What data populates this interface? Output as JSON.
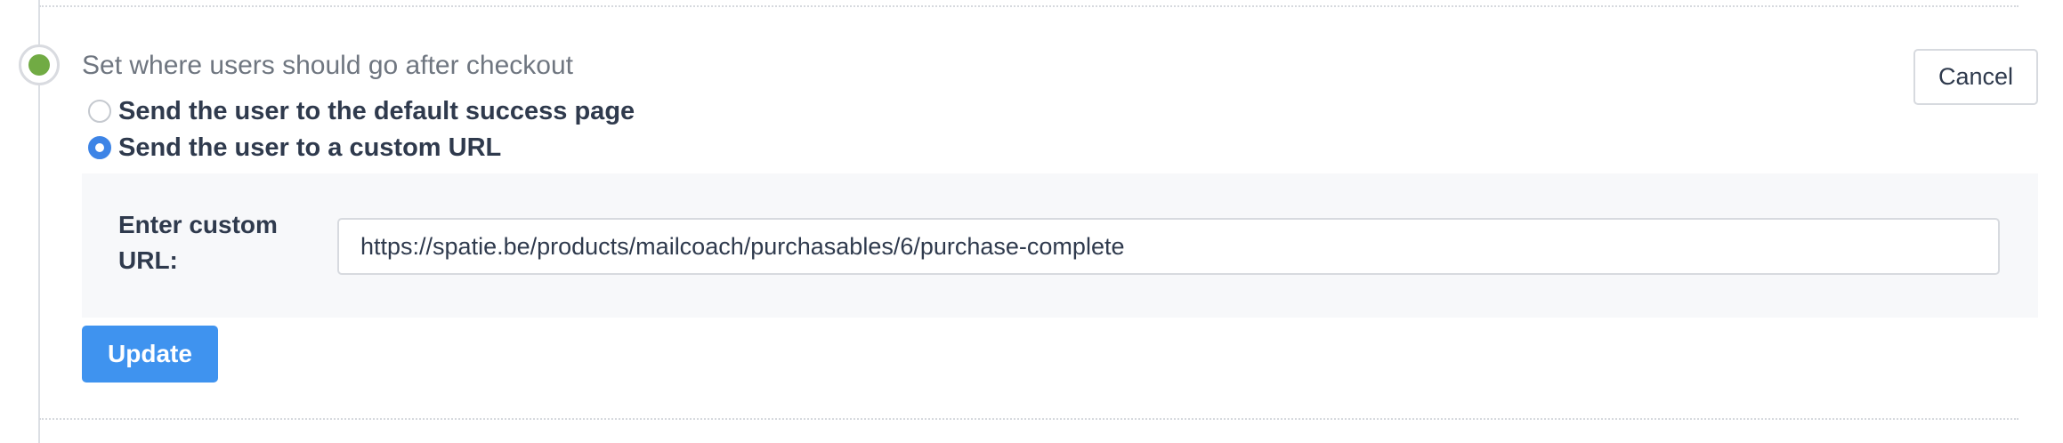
{
  "step": {
    "title": "Set where users should go after checkout",
    "status_color": "#71ab44"
  },
  "actions": {
    "cancel_label": "Cancel",
    "update_label": "Update"
  },
  "redirect_options": [
    {
      "label": "Send the user to the default success page",
      "selected": false
    },
    {
      "label": "Send the user to a custom URL",
      "selected": true
    }
  ],
  "custom_url": {
    "label": "Enter custom URL:",
    "value": "https://spatie.be/products/mailcoach/purchasables/6/purchase-complete"
  },
  "colors": {
    "accent": "#3f93ef",
    "radio_selected": "#3d84e6",
    "status_complete": "#71ab44"
  }
}
